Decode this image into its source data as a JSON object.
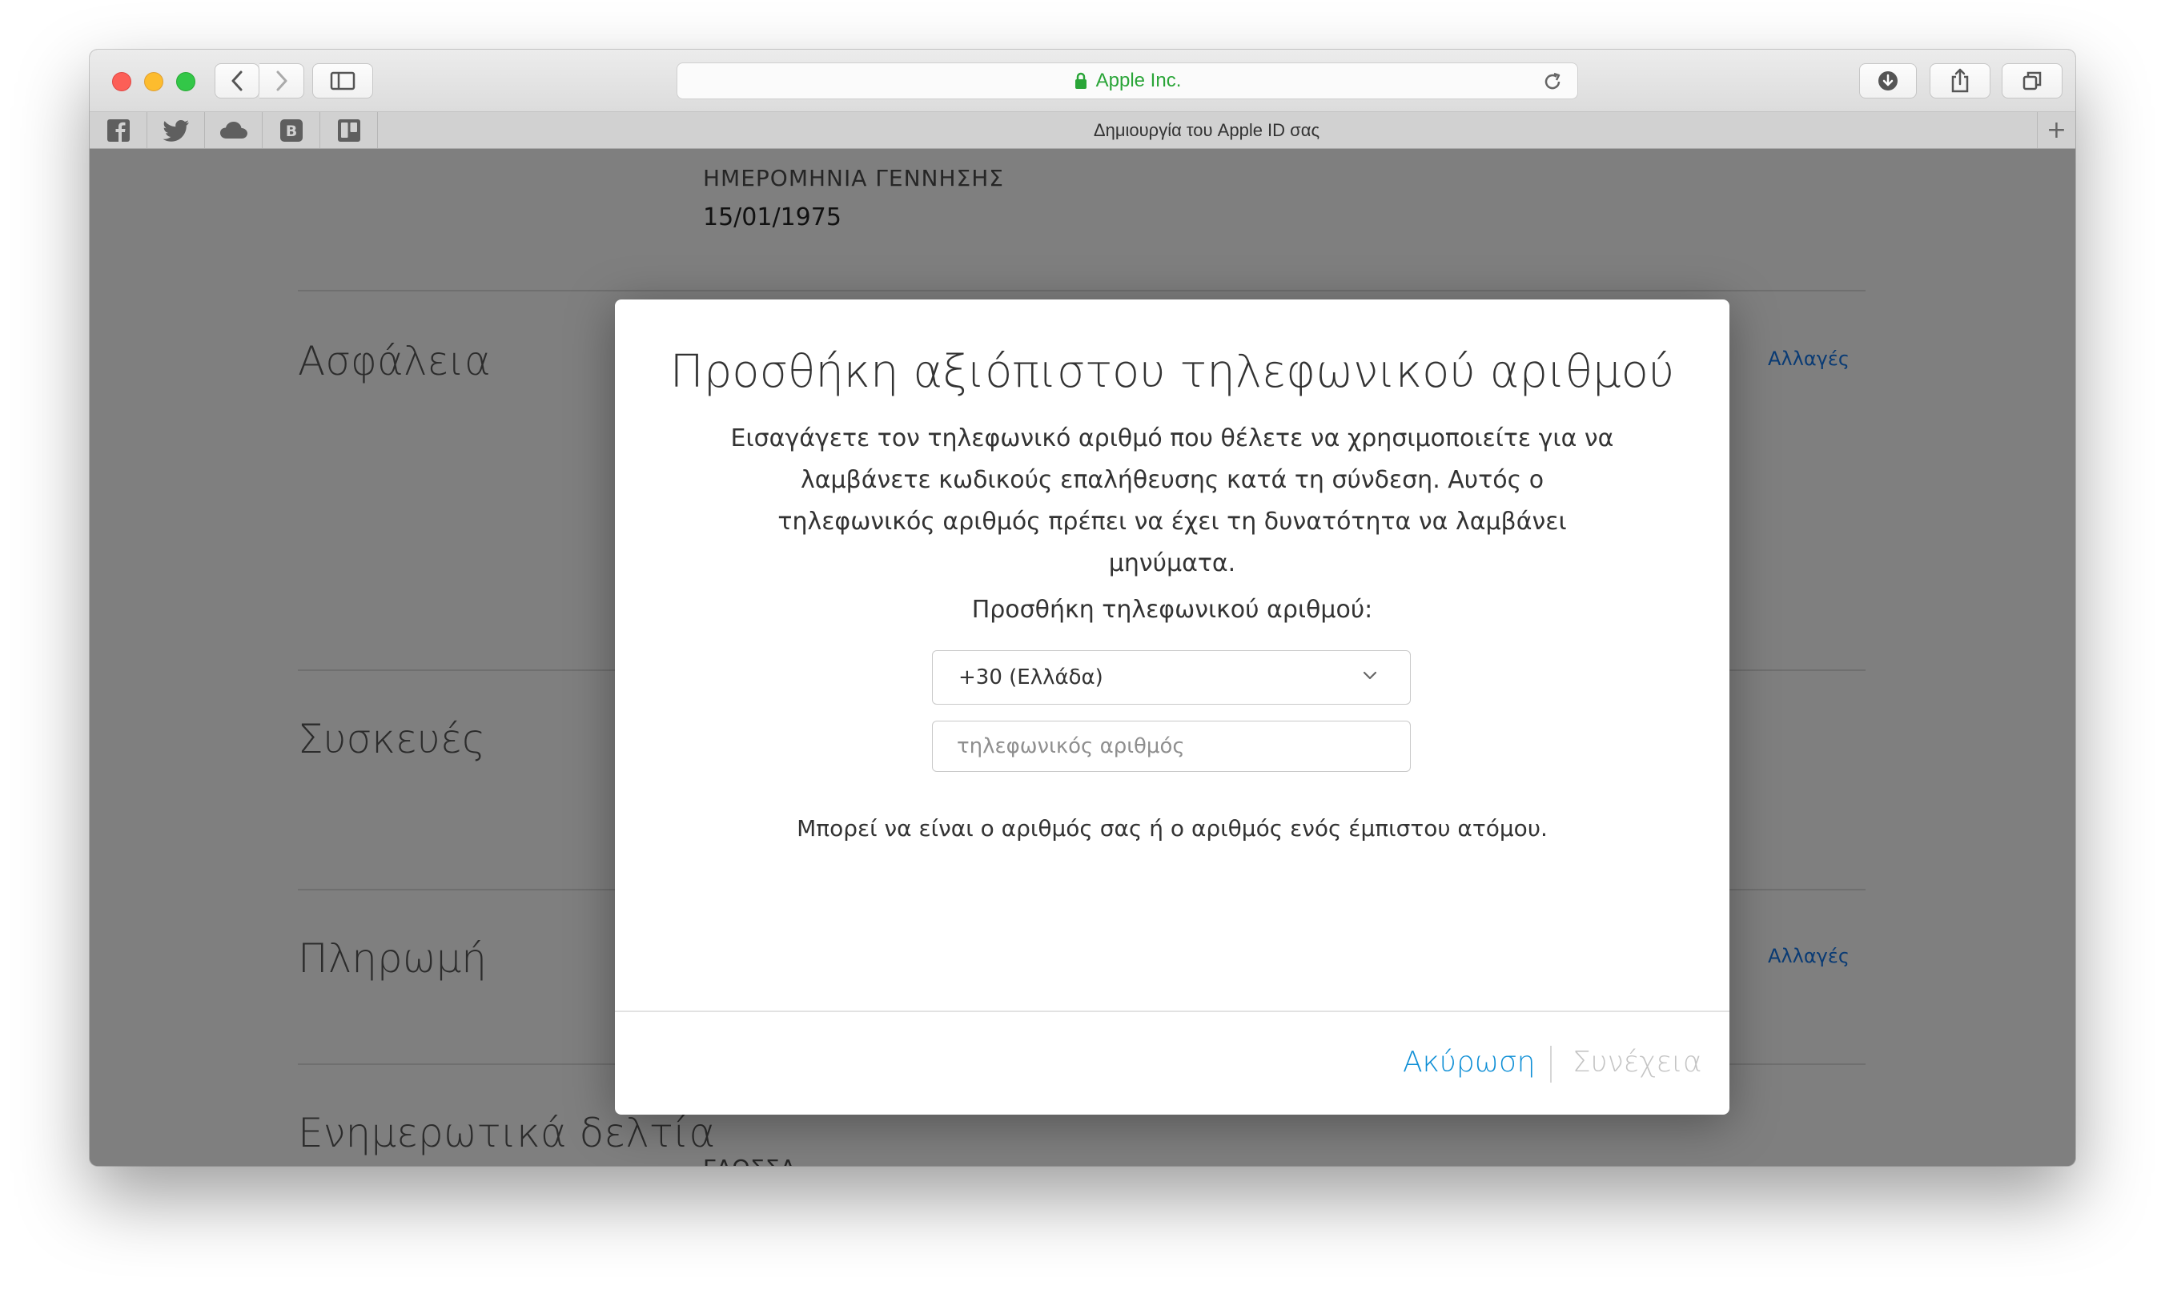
{
  "browser": {
    "address": "Apple Inc.",
    "tab_title": "Δημιουργία του Apple ID σας",
    "new_tab_label": "+",
    "favorites": [
      "facebook-icon",
      "twitter-icon",
      "cloud-icon",
      "b-icon",
      "trello-icon"
    ],
    "favorite_b_letter": "B",
    "url_color": "#2aa538"
  },
  "background_page": {
    "dob_label": "ΗΜΕΡΟΜΗΝΙΑ ΓΕΝΝΗΣΗΣ",
    "dob_value": "15/01/1975",
    "sections": {
      "security": "Ασφάλεια",
      "devices": "Συσκευές",
      "payment": "Πληρωμή",
      "newsletters": "Ενημερωτικά δελτία"
    },
    "edit_link": "Αλλαγές",
    "language_label": "ΓΛΩΣΣΑ"
  },
  "modal": {
    "title": "Προσθήκη αξιόπιστου τηλεφωνικού αριθμού",
    "description": "Εισαγάγετε τον τηλεφωνικό αριθμό που θέλετε να χρησιμοποιείτε για να λαμβάνετε κωδικούς επαλήθευσης κατά τη σύνδεση. Αυτός ο τηλεφωνικός αριθμός πρέπει να έχει τη δυνατότητα να λαμβάνει μηνύματα.",
    "field_label": "Προσθήκη τηλεφωνικού αριθμού:",
    "country_value": "+30 (Ελλάδα)",
    "phone_placeholder": "τηλεφωνικός αριθμός",
    "hint": "Μπορεί να είναι ο αριθμός σας ή ο αριθμός ενός έμπιστου ατόμου.",
    "cancel_label": "Ακύρωση",
    "continue_label": "Συνέχεια",
    "accent_color": "#0f8fd6"
  }
}
